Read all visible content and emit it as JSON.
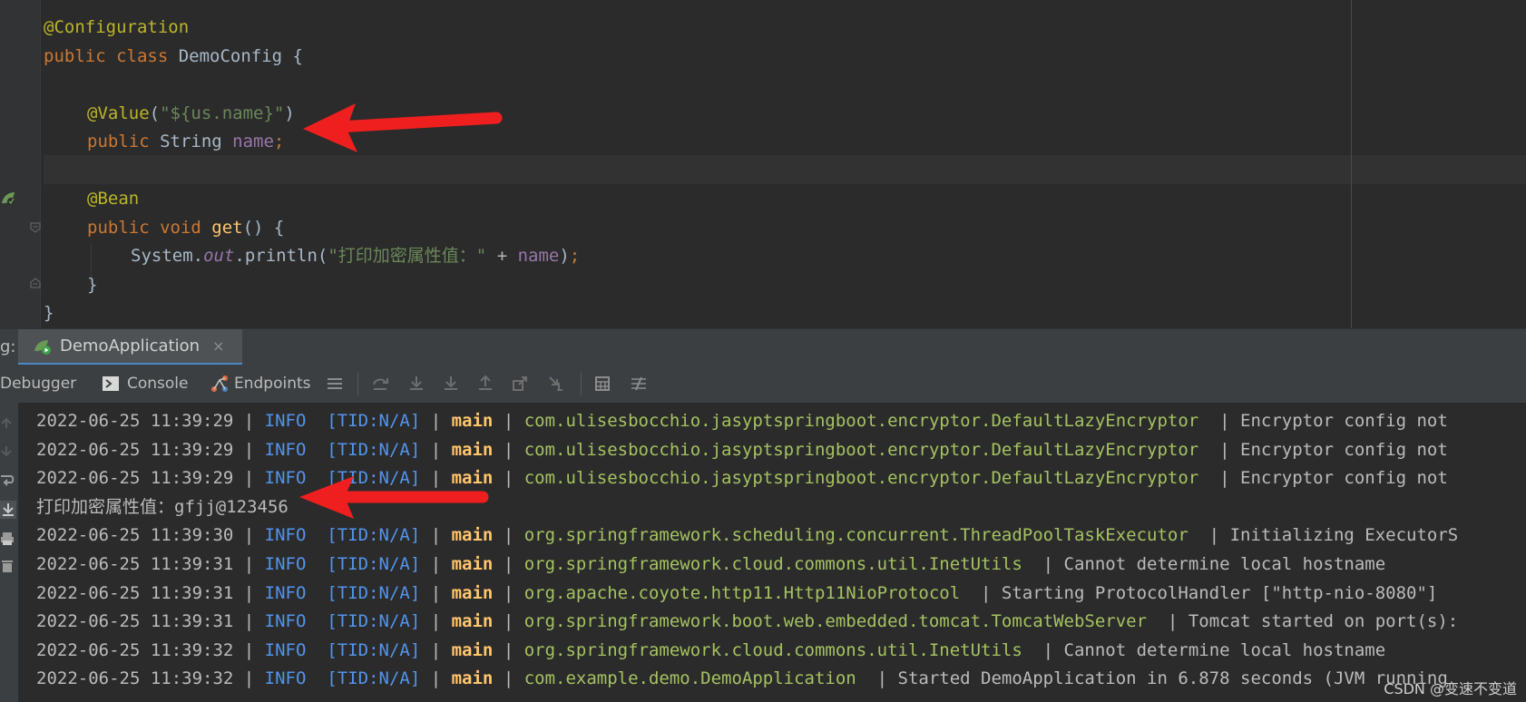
{
  "editor": {
    "lines": [
      {
        "indent": 0,
        "tokens": [
          {
            "t": "@Configuration",
            "c": "ann"
          }
        ]
      },
      {
        "indent": 0,
        "tokens": [
          {
            "t": "public ",
            "c": "kw"
          },
          {
            "t": "class ",
            "c": "kw"
          },
          {
            "t": "DemoConfig {",
            "c": "txt"
          }
        ]
      },
      {
        "indent": 0,
        "tokens": []
      },
      {
        "indent": 1,
        "tokens": [
          {
            "t": "@Value",
            "c": "ann"
          },
          {
            "t": "(",
            "c": "txt"
          },
          {
            "t": "\"${us.name}\"",
            "c": "str"
          },
          {
            "t": ")",
            "c": "txt"
          }
        ]
      },
      {
        "indent": 1,
        "tokens": [
          {
            "t": "public ",
            "c": "kw"
          },
          {
            "t": "String ",
            "c": "txt"
          },
          {
            "t": "name",
            "c": "field"
          },
          {
            "t": ";",
            "c": "kw"
          }
        ]
      },
      {
        "indent": 0,
        "tokens": []
      },
      {
        "indent": 1,
        "tokens": [
          {
            "t": "@Bean",
            "c": "ann"
          }
        ]
      },
      {
        "indent": 1,
        "tokens": [
          {
            "t": "public ",
            "c": "kw"
          },
          {
            "t": "void ",
            "c": "kw"
          },
          {
            "t": "get",
            "c": "method"
          },
          {
            "t": "() {",
            "c": "txt"
          }
        ]
      },
      {
        "indent": 2,
        "tokens": [
          {
            "t": "System.",
            "c": "txt"
          },
          {
            "t": "out",
            "c": "static"
          },
          {
            "t": ".println(",
            "c": "txt"
          },
          {
            "t": "\"打印加密属性值：\"",
            "c": "str"
          },
          {
            "t": " + ",
            "c": "txt"
          },
          {
            "t": "name",
            "c": "field"
          },
          {
            "t": ")",
            "c": "txt"
          },
          {
            "t": ";",
            "c": "kw"
          }
        ]
      },
      {
        "indent": 1,
        "tokens": [
          {
            "t": "}",
            "c": "txt"
          }
        ]
      },
      {
        "indent": 0,
        "tokens": [
          {
            "t": "}",
            "c": "txt"
          }
        ]
      }
    ]
  },
  "run_panel": {
    "prefix": "g:",
    "tab_label": "DemoApplication",
    "tab_close": "×"
  },
  "toolbar": {
    "debugger_label": "Debugger",
    "console_label": "Console",
    "endpoints_label": "Endpoints"
  },
  "console": {
    "lines": [
      {
        "type": "log",
        "ts": "2022-06-25 11:39:29",
        "level": "INFO",
        "tid": "[TID:N/A]",
        "thread": "main",
        "cls": "com.ulisesbocchio.jasyptspringboot.encryptor.DefaultLazyEncryptor",
        "msg": "Encryptor config not"
      },
      {
        "type": "log",
        "ts": "2022-06-25 11:39:29",
        "level": "INFO",
        "tid": "[TID:N/A]",
        "thread": "main",
        "cls": "com.ulisesbocchio.jasyptspringboot.encryptor.DefaultLazyEncryptor",
        "msg": "Encryptor config not"
      },
      {
        "type": "log",
        "ts": "2022-06-25 11:39:29",
        "level": "INFO",
        "tid": "[TID:N/A]",
        "thread": "main",
        "cls": "com.ulisesbocchio.jasyptspringboot.encryptor.DefaultLazyEncryptor",
        "msg": "Encryptor config not"
      },
      {
        "type": "plain",
        "text": "打印加密属性值：gfjj@123456"
      },
      {
        "type": "log",
        "ts": "2022-06-25 11:39:30",
        "level": "INFO",
        "tid": "[TID:N/A]",
        "thread": "main",
        "cls": "org.springframework.scheduling.concurrent.ThreadPoolTaskExecutor",
        "msg": "Initializing ExecutorS"
      },
      {
        "type": "log",
        "ts": "2022-06-25 11:39:31",
        "level": "INFO",
        "tid": "[TID:N/A]",
        "thread": "main",
        "cls": "org.springframework.cloud.commons.util.InetUtils",
        "msg": "Cannot determine local hostname"
      },
      {
        "type": "log",
        "ts": "2022-06-25 11:39:31",
        "level": "INFO",
        "tid": "[TID:N/A]",
        "thread": "main",
        "cls": "org.apache.coyote.http11.Http11NioProtocol",
        "msg": "Starting ProtocolHandler [\"http-nio-8080\"]"
      },
      {
        "type": "log",
        "ts": "2022-06-25 11:39:31",
        "level": "INFO",
        "tid": "[TID:N/A]",
        "thread": "main",
        "cls": "org.springframework.boot.web.embedded.tomcat.TomcatWebServer",
        "msg": "Tomcat started on port(s):"
      },
      {
        "type": "log",
        "ts": "2022-06-25 11:39:32",
        "level": "INFO",
        "tid": "[TID:N/A]",
        "thread": "main",
        "cls": "org.springframework.cloud.commons.util.InetUtils",
        "msg": "Cannot determine local hostname"
      },
      {
        "type": "log",
        "ts": "2022-06-25 11:39:32",
        "level": "INFO",
        "tid": "[TID:N/A]",
        "thread": "main",
        "cls": "com.example.demo.DemoApplication",
        "msg": "Started DemoApplication in 6.878 seconds (JVM running"
      }
    ]
  },
  "watermark": "CSDN @变速不变道",
  "colors": {
    "arrow": "#f01f1f",
    "background": "#2b2b2b",
    "panel": "#3c3f41"
  },
  "icons": [
    "spring-bean-icon",
    "fold-icon",
    "spring-run-icon",
    "console-icon",
    "endpoints-icon",
    "menu-icon",
    "step-over-icon",
    "step-into-icon",
    "force-step-into-icon",
    "step-out-icon",
    "drop-frame-icon",
    "run-to-cursor-icon",
    "evaluate-icon",
    "trace-icon",
    "scroll-up-icon",
    "scroll-down-icon",
    "soft-wrap-icon",
    "scroll-end-icon",
    "print-icon",
    "trash-icon"
  ]
}
